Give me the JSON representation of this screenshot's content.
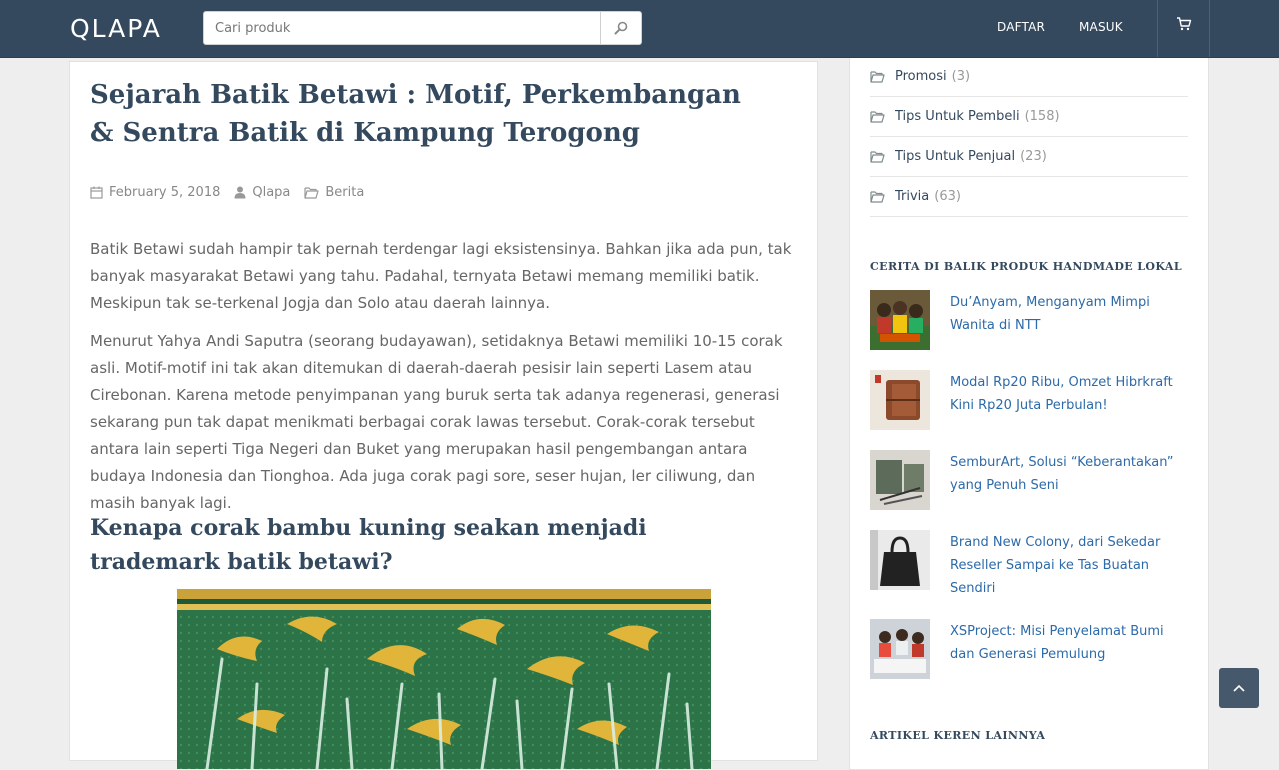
{
  "header": {
    "logo": "QLAPA",
    "search_placeholder": "Cari produk",
    "register_label": "DAFTAR",
    "login_label": "MASUK"
  },
  "article": {
    "title": "Sejarah Batik Betawi : Motif, Perkembangan & Sentra Batik di Kampung Terogong",
    "date": "February 5, 2018",
    "author": "Qlapa",
    "category": "Berita",
    "paragraph_1": "Batik Betawi sudah hampir tak pernah terdengar lagi eksistensinya. Bahkan jika ada pun, tak banyak masyarakat Betawi yang tahu. Padahal, ternyata Betawi memang memiliki batik. Meskipun tak se-terkenal Jogja dan Solo atau daerah lainnya.",
    "paragraph_2": "Menurut Yahya Andi Saputra (seorang budayawan), setidaknya Betawi memiliki 10-15 corak asli. Motif-motif ini tak akan ditemukan di daerah-daerah pesisir lain seperti Lasem atau Cirebonan. Karena metode penyimpanan yang buruk serta tak adanya regenerasi, generasi sekarang pun tak dapat menikmati berbagai corak lawas tersebut. Corak-corak tersebut antara lain seperti Tiga Negeri dan Buket yang merupakan hasil pengembangan antara budaya Indonesia dan Tionghoa. Ada juga corak pagi sore, seser hujan, ler ciliwung, dan masih banyak lagi.",
    "subheading": "Kenapa corak bambu kuning seakan menjadi trademark batik betawi?"
  },
  "sidebar": {
    "categories": [
      {
        "name": "Promosi",
        "count": "(3)"
      },
      {
        "name": "Tips Untuk Pembeli",
        "count": "(158)"
      },
      {
        "name": "Tips Untuk Penjual",
        "count": "(23)"
      },
      {
        "name": "Trivia",
        "count": "(63)"
      }
    ],
    "stories_title": "CERITA DI BALIK PRODUK HANDMADE LOKAL",
    "stories": [
      {
        "title": "Du’Anyam, Menganyam Mimpi Wanita di NTT"
      },
      {
        "title": "Modal Rp20 Ribu, Omzet Hibrkraft Kini Rp20 Juta Perbulan!"
      },
      {
        "title": "SemburArt, Solusi “Keberantakan” yang Penuh Seni"
      },
      {
        "title": "Brand New Colony, dari Sekedar Reseller Sampai ke Tas Buatan Sendiri"
      },
      {
        "title": "XSProject: Misi Penyelamat Bumi dan Generasi Pemulung"
      }
    ],
    "more_title": "ARTIKEL KEREN LAINNYA"
  },
  "colors": {
    "header_bg": "#34495e",
    "heading": "#34495e",
    "link": "#2c6aa8",
    "batik_green": "#2f7a4a",
    "batik_gold": "#e0b53a"
  }
}
